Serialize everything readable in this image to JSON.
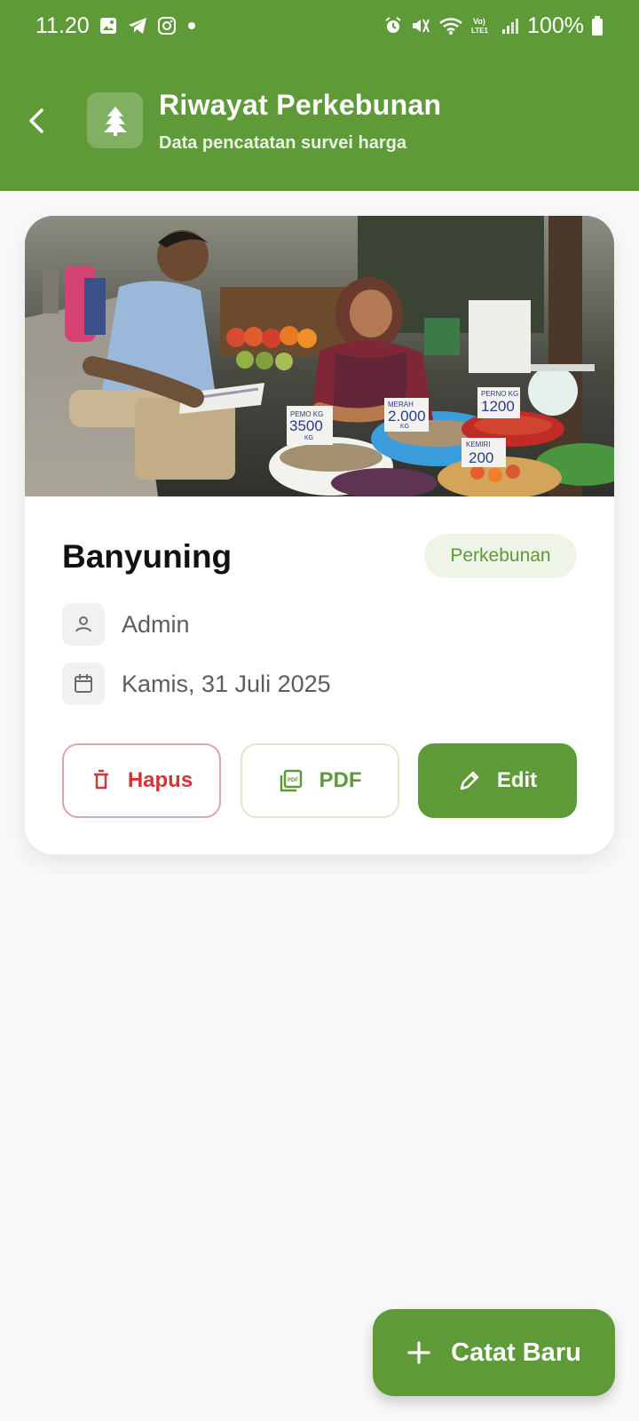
{
  "status_bar": {
    "time": "11.20",
    "battery": "100%",
    "icons_left": [
      "gallery-icon",
      "telegram-icon",
      "instagram-icon",
      "notification-dot-icon"
    ],
    "icons_right": [
      "alarm-icon",
      "mute-icon",
      "wifi-icon",
      "volte-icon",
      "signal-icon",
      "battery-icon"
    ],
    "volte_label": "Vo)\nLTE1"
  },
  "header": {
    "title": "Riwayat Perkebunan",
    "subtitle": "Data pencatatan survei harga",
    "icon": "tree-icon",
    "color": "#5f9a38"
  },
  "card": {
    "image_alt": "market-survey-photo",
    "image_signs": [
      "PEMO KG",
      "3500",
      "KG",
      "MERAH",
      "2.000",
      "KG",
      "PERNO KG",
      "1200",
      "KEMIRI",
      "200"
    ],
    "title": "Banyuning",
    "badge": "Perkebunan",
    "author": "Admin",
    "date": "Kamis, 31 Juli 2025",
    "buttons": {
      "delete": "Hapus",
      "pdf": "PDF",
      "edit": "Edit"
    }
  },
  "fab": {
    "label": "Catat Baru"
  },
  "colors": {
    "primary": "#5f9a38",
    "danger": "#d33535",
    "background": "#f8f8f8",
    "card": "#ffffff"
  }
}
